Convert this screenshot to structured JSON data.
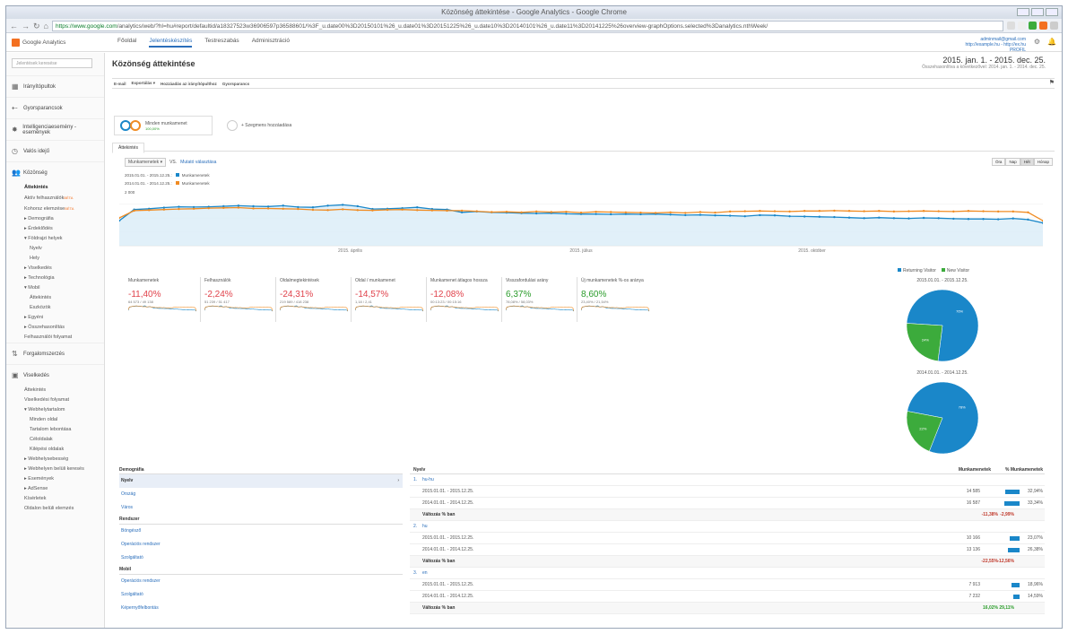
{
  "window": {
    "title": "Közönség áttekintése - Google Analytics - Google Chrome"
  },
  "browser": {
    "url_host": "https://www.google.com",
    "url_rest": "/analytics/web/?hl=hu#report/defaultid/a18327523w36906597p36588601/%3F_u.date00%3D20150101%26_u.date01%3D20151225%26_u.date10%3D20140101%26_u.date11%3D20141225%26overview-graphOptions.selected%3Danalytics.nthWeek/"
  },
  "app": {
    "name": "Google Analytics"
  },
  "topnav": [
    {
      "label": "Főoldal"
    },
    {
      "label": "Jelentéskészítés"
    },
    {
      "label": "Testreszabás"
    },
    {
      "label": "Adminisztráció"
    }
  ],
  "account": {
    "line1": "adminmail@gmail.com",
    "line2": "http://example.hu - http://ex.hu",
    "line3": "PROFIL"
  },
  "sidebar": {
    "search_placeholder": "Jelentések keresése",
    "sections": [
      {
        "label": "Irányítópultok"
      },
      {
        "label": "Gyorsparancsok"
      },
      {
        "label": "Intelligenciaesemény - események"
      },
      {
        "label": "Valós idejű"
      },
      {
        "label": "Közönség"
      }
    ],
    "audience_items": [
      {
        "label": "Áttekintés",
        "level": 1,
        "selected": true
      },
      {
        "label": "Aktív felhasználók",
        "level": 1,
        "badge": "BÉTA"
      },
      {
        "label": "Kohorsz elemzése",
        "level": 1,
        "badge": "BÉTA"
      },
      {
        "label": "▸ Demográfia",
        "level": 1
      },
      {
        "label": "▸ Érdeklődés",
        "level": 1
      },
      {
        "label": "▾ Földrajzi helyek",
        "level": 1
      },
      {
        "label": "Nyelv",
        "level": 2
      },
      {
        "label": "Hely",
        "level": 2
      },
      {
        "label": "▸ Viselkedés",
        "level": 1
      },
      {
        "label": "▸ Technológia",
        "level": 1
      },
      {
        "label": "▾ Mobil",
        "level": 1
      },
      {
        "label": "Áttekintés",
        "level": 2
      },
      {
        "label": "Eszközök",
        "level": 2
      },
      {
        "label": "▸ Egyéni",
        "level": 1
      },
      {
        "label": "▸ Összehasonlítás",
        "level": 1
      },
      {
        "label": "Felhasználói folyamat",
        "level": 1
      }
    ],
    "sections2": [
      {
        "label": "Forgalomszerzés"
      },
      {
        "label": "Viselkedés"
      }
    ],
    "behavior_items": [
      {
        "label": "Áttekintés",
        "level": 1
      },
      {
        "label": "Viselkedési folyamat",
        "level": 1
      },
      {
        "label": "▾ Webhelytartalom",
        "level": 1
      },
      {
        "label": "Minden oldal",
        "level": 2
      },
      {
        "label": "Tartalom lebontása",
        "level": 2
      },
      {
        "label": "Céloldalak",
        "level": 2
      },
      {
        "label": "Kilépési oldalak",
        "level": 2
      },
      {
        "label": "▸ Webhelysebesség",
        "level": 1
      },
      {
        "label": "▸ Webhelyen belüli keresés",
        "level": 1
      },
      {
        "label": "▸ Események",
        "level": 1
      },
      {
        "label": "▸ AdSense",
        "level": 1
      },
      {
        "label": "Kísérletek",
        "level": 1
      },
      {
        "label": "Oldalon belüli elemzés",
        "level": 1
      }
    ]
  },
  "page": {
    "title": "Közönség áttekintése",
    "date_main": "2015. jan. 1. - 2015. dec. 25.",
    "date_compare": "Összehasonlítva a következővel: 2014. jan. 1. - 2014. dec. 25.",
    "actions": [
      "E-mail",
      "Exportálás ▾",
      "Hozzáadás az irányítópulthoz",
      "Gyorsparancs"
    ]
  },
  "segments": [
    {
      "name": "Minden munkamenet",
      "pct": "100,00%"
    },
    {
      "name": "+ Szegmens hozzáadása"
    }
  ],
  "tab_label": "Áttekintés",
  "metric_select": "Munkamenetek ▾",
  "metric_vs": "VS.",
  "metric_link": "Mutató választása",
  "granularity": [
    {
      "label": "Óra"
    },
    {
      "label": "Nap"
    },
    {
      "label": "Hét",
      "active": true
    },
    {
      "label": "Hónap"
    }
  ],
  "legend": {
    "row1_date": "2015.01.01. - 2015.12.25.:",
    "row1_series": "Munkamenetek",
    "row2_date": "2014.01.01. - 2014.12.25.:",
    "row2_series": "Munkamenetek",
    "y_label": "2 000"
  },
  "chart_data": {
    "type": "line",
    "x_labels": [
      "2015. április",
      "2015. július",
      "2015. október"
    ],
    "ylim": [
      0,
      2000
    ],
    "series": [
      {
        "name": "2015.01.01. - 2015.12.25.: Munkamenetek",
        "color": "#1a87c9",
        "values": [
          900,
          1300,
          1330,
          1370,
          1400,
          1390,
          1400,
          1420,
          1440,
          1420,
          1410,
          1440,
          1390,
          1380,
          1440,
          1470,
          1420,
          1320,
          1330,
          1350,
          1380,
          1320,
          1300,
          1200,
          1230,
          1200,
          1190,
          1170,
          1160,
          1170,
          1150,
          1140,
          1140,
          1130,
          1140,
          1130,
          1140,
          1120,
          1100,
          1110,
          1090,
          1080,
          1060,
          1100,
          1090,
          1060,
          1050,
          1040,
          1030,
          1010,
          990,
          1010,
          990,
          980,
          1000,
          990,
          970,
          960,
          960,
          950,
          980,
          940,
          820
        ]
      },
      {
        "name": "2014.01.01. - 2014.12.25.: Munkamenetek",
        "color": "#f08c24",
        "values": [
          1000,
          1260,
          1280,
          1300,
          1320,
          1330,
          1350,
          1360,
          1370,
          1340,
          1340,
          1330,
          1320,
          1290,
          1280,
          1310,
          1280,
          1270,
          1290,
          1300,
          1280,
          1270,
          1260,
          1260,
          1240,
          1210,
          1220,
          1200,
          1230,
          1210,
          1220,
          1190,
          1220,
          1210,
          1200,
          1190,
          1180,
          1200,
          1180,
          1210,
          1190,
          1230,
          1240,
          1250,
          1240,
          1230,
          1250,
          1250,
          1260,
          1250,
          1240,
          1250,
          1230,
          1240,
          1250,
          1240,
          1230,
          1250,
          1240,
          1230,
          1230,
          1200,
          900
        ]
      }
    ]
  },
  "metrics": [
    {
      "name": "Munkamenetek",
      "value": "-11,40%",
      "sub": "64 573 / 49 138",
      "dir": "neg"
    },
    {
      "name": "Felhasználók",
      "value": "-2,24%",
      "sub": "51 239 / 51 417",
      "dir": "neg"
    },
    {
      "name": "Oldalmegtekintések",
      "value": "-24,31%",
      "sub": "219 589 / 418 238",
      "dir": "neg"
    },
    {
      "name": "Oldal / munkamenet",
      "value": "-14,57%",
      "sub": "1,18 / 2,41",
      "dir": "neg"
    },
    {
      "name": "Munkamenet átlagos hossza",
      "value": "-12,08%",
      "sub": "00:13:23 / 00:15:16",
      "dir": "neg"
    },
    {
      "name": "Visszafordulási arány",
      "value": "6,37%",
      "sub": "78,08% / 58,03%",
      "dir": "pos"
    },
    {
      "name": "Új munkamenetek %-os aránya",
      "value": "8,60%",
      "sub": "23,40% / 21,54%",
      "dir": "pos"
    }
  ],
  "pie_legend": [
    {
      "label": "Returning Visitor",
      "color": "#1a87c9"
    },
    {
      "label": "New Visitor",
      "color": "#3cab3c"
    }
  ],
  "pies": [
    {
      "title": "2015.01.01. - 2015.12.25.",
      "slices": [
        {
          "label": "Returning Visitor",
          "value": 76
        },
        {
          "label": "New Visitor",
          "value": 24
        }
      ]
    },
    {
      "title": "2014.01.01. - 2014.12.25.",
      "slices": [
        {
          "label": "Returning Visitor",
          "value": 78
        },
        {
          "label": "New Visitor",
          "value": 22
        }
      ]
    }
  ],
  "left_table": {
    "header": "Demográfia",
    "groups": [
      {
        "title": "",
        "rows": [
          {
            "label": "Nyelv",
            "selected": true
          },
          {
            "label": "Ország"
          },
          {
            "label": "Város"
          }
        ]
      },
      {
        "title": "Rendszer",
        "rows": [
          {
            "label": "Böngésző"
          },
          {
            "label": "Operációs rendszer"
          },
          {
            "label": "Szolgáltató"
          }
        ]
      },
      {
        "title": "Mobil",
        "rows": [
          {
            "label": "Operációs rendszer"
          },
          {
            "label": "Szolgáltató"
          },
          {
            "label": "Képernyőfelbontás"
          }
        ]
      }
    ]
  },
  "right_table": {
    "col1": "Nyelv",
    "col2": "Munkamenetek",
    "col3": "% Munkamenetek",
    "groups": [
      {
        "rank": "1.",
        "name": "hu-hu",
        "rows": [
          {
            "date": "2015.01.01. - 2015.12.25.",
            "sessions": "14 585",
            "pct": "32,94%",
            "pctval": 32.94
          },
          {
            "date": "2014.01.01. - 2014.12.25.",
            "sessions": "16 587",
            "pct": "33,34%",
            "pctval": 33.34
          }
        ],
        "change": {
          "label": "Változás % ban",
          "a": "-11,38%",
          "b": "-2,99%"
        }
      },
      {
        "rank": "2.",
        "name": "hu",
        "rows": [
          {
            "date": "2015.01.01. - 2015.12.25.",
            "sessions": "10 166",
            "pct": "23,07%",
            "pctval": 23.07
          },
          {
            "date": "2014.01.01. - 2014.12.25.",
            "sessions": "13 136",
            "pct": "26,38%",
            "pctval": 26.38
          }
        ],
        "change": {
          "label": "Változás % ban",
          "a": "-22,55%",
          "b": "-12,56%"
        }
      },
      {
        "rank": "3.",
        "name": "en",
        "rows": [
          {
            "date": "2015.01.01. - 2015.12.25.",
            "sessions": "7 913",
            "pct": "18,96%",
            "pctval": 18.96
          },
          {
            "date": "2014.01.01. - 2014.12.25.",
            "sessions": "7 232",
            "pct": "14,59%",
            "pctval": 14.59
          }
        ],
        "change": {
          "label": "Változás % ban",
          "a": "16,02%",
          "b": "29,11%"
        }
      }
    ]
  }
}
